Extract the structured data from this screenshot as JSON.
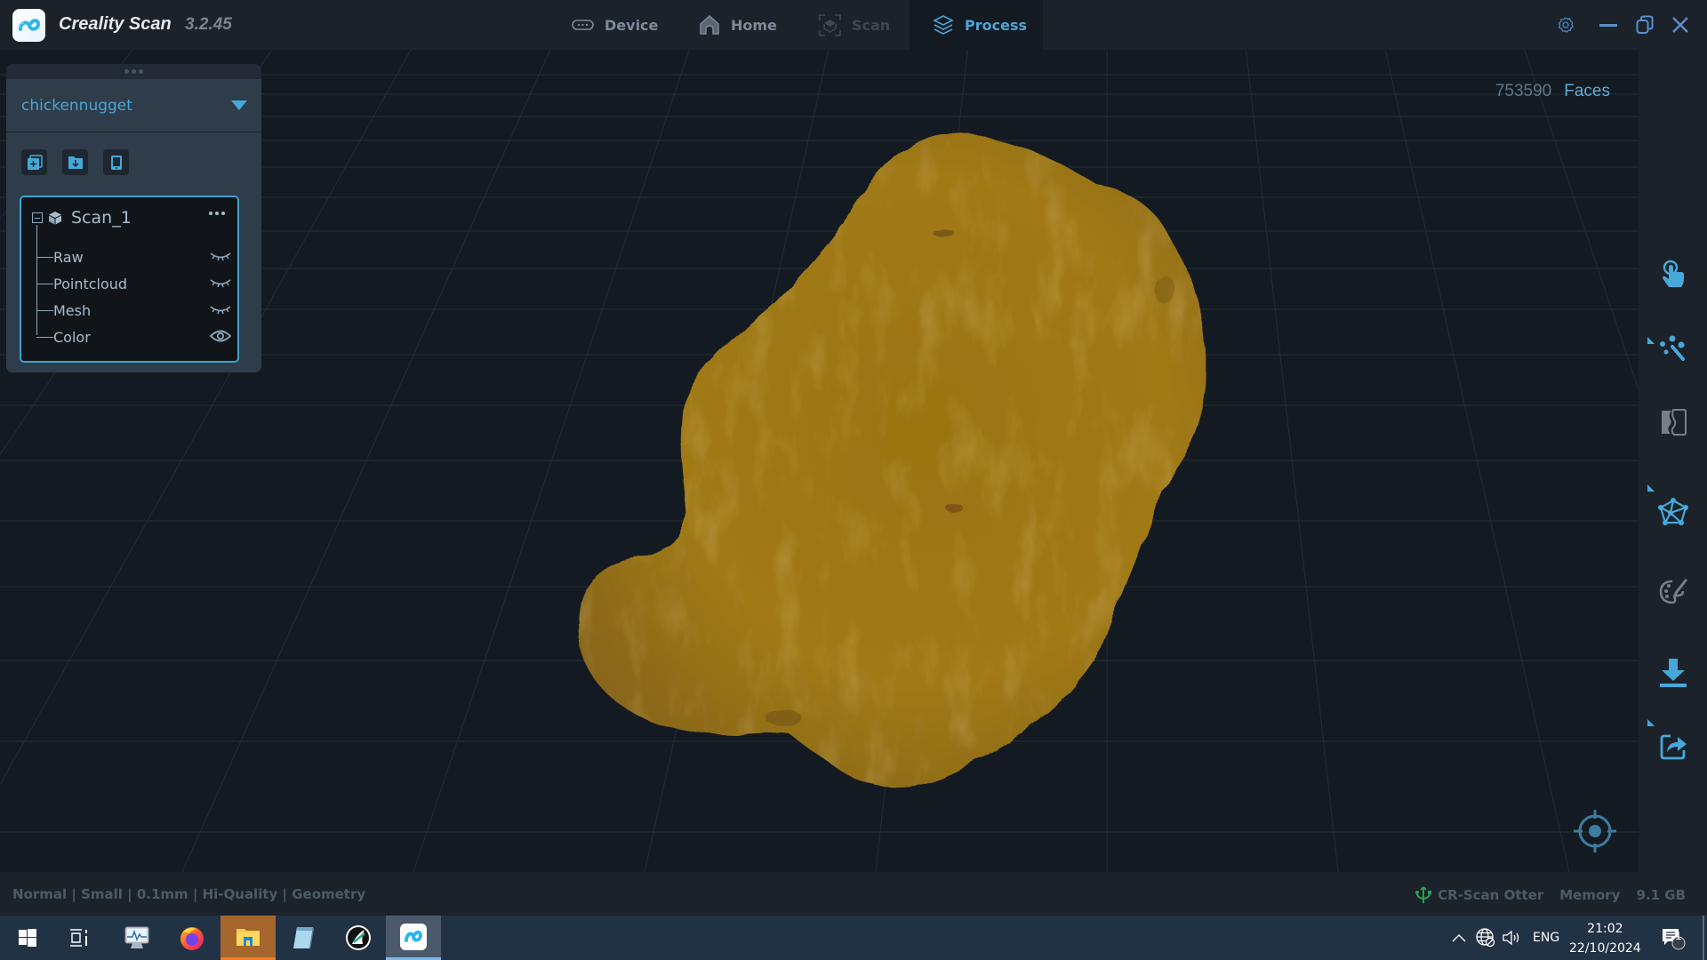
{
  "app": {
    "title": "Creality Scan",
    "version": "3.2.45"
  },
  "nav": {
    "tabs": [
      {
        "label": "Device",
        "icon": "device-icon",
        "state": "normal"
      },
      {
        "label": "Home",
        "icon": "home-icon",
        "state": "normal"
      },
      {
        "label": "Scan",
        "icon": "scan-icon",
        "state": "disabled"
      },
      {
        "label": "Process",
        "icon": "layers-icon",
        "state": "active"
      }
    ]
  },
  "window_controls": [
    "settings-icon",
    "minimize-icon",
    "restore-icon",
    "close-icon"
  ],
  "project_panel": {
    "project_name": "chickennugget",
    "buttons": [
      "add-scan-icon",
      "import-folder-icon",
      "device-import-icon"
    ],
    "tree": {
      "root": "Scan_1",
      "children": [
        {
          "label": "Raw",
          "visible": false
        },
        {
          "label": "Pointcloud",
          "visible": false
        },
        {
          "label": "Mesh",
          "visible": false
        },
        {
          "label": "Color",
          "visible": true
        }
      ]
    }
  },
  "viewport": {
    "face_count": "753590",
    "face_label": "Faces",
    "model_color": "#a87f17"
  },
  "right_toolbar": [
    {
      "name": "select-tool",
      "icon": "pointer-hand-icon",
      "enabled": true,
      "has_submenu": false
    },
    {
      "name": "edit-points-tool",
      "icon": "magic-wand-icon",
      "enabled": true,
      "has_submenu": true
    },
    {
      "name": "align-tool",
      "icon": "align-merge-icon",
      "enabled": false,
      "has_submenu": false
    },
    {
      "name": "mesh-tool",
      "icon": "mesh-network-icon",
      "enabled": true,
      "has_submenu": true
    },
    {
      "name": "texture-tool",
      "icon": "palette-icon",
      "enabled": false,
      "has_submenu": false
    },
    {
      "name": "export-tool",
      "icon": "download-icon",
      "enabled": true,
      "has_submenu": false
    },
    {
      "name": "share-tool",
      "icon": "share-icon",
      "enabled": true,
      "has_submenu": true
    }
  ],
  "status": {
    "settings": "Normal | Small | 0.1mm | Hi-Quality | Geometry",
    "device": "CR-Scan Otter",
    "memory_label": "Memory",
    "memory_value": "9.1 GB"
  },
  "taskbar": {
    "apps": [
      "windows-start-icon",
      "task-view-icon",
      "performance-monitor-icon",
      "firefox-icon",
      "file-explorer-icon",
      "notepad-icon",
      "orca-app-icon",
      "creality-scan-icon"
    ],
    "language": "ENG",
    "time": "21:02",
    "date": "22/10/2024",
    "notification_count": "1"
  },
  "colors": {
    "accent": "#4aa5d6",
    "background": "#141a21",
    "panel": "#2f3c49",
    "usb_connected": "#1fa650"
  }
}
